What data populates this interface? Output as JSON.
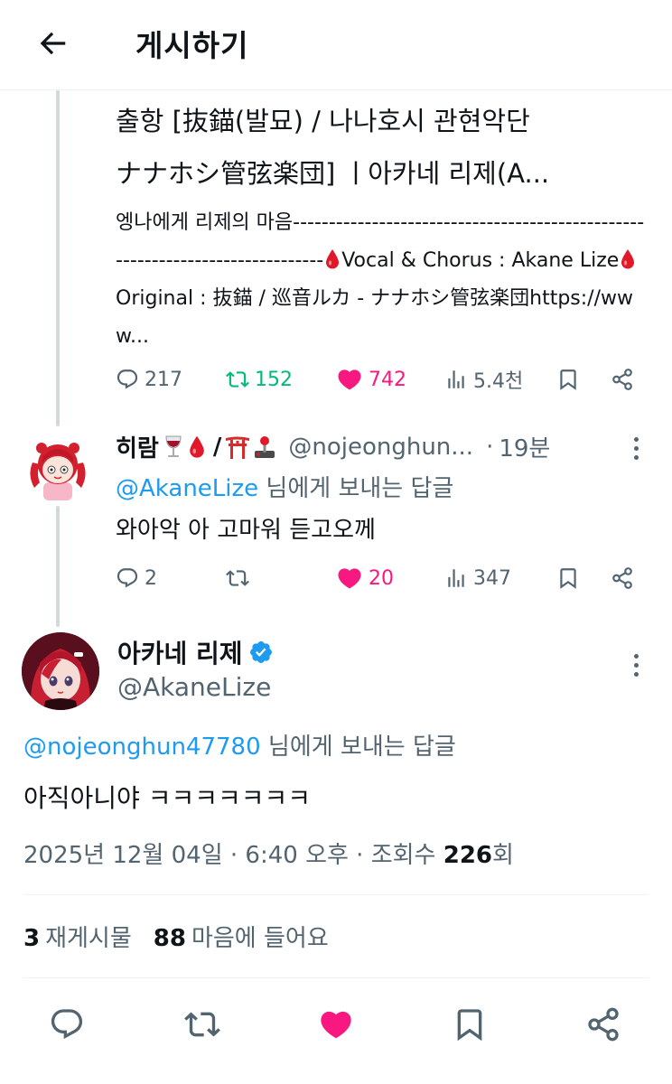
{
  "header": {
    "title": "게시하기"
  },
  "card": {
    "title_line1": "출항 [抜錨(발묘) / 나나호시 관현악단",
    "title_line2": "ナナホシ管弦楽団] ㅣ아카네 리제(A...",
    "desc_part1": "엥나에게 리제의 마음------------------------------------------------------------------------------",
    "desc_part2": "Vocal & Chorus : Akane Lize",
    "desc_part3": "Original : 抜錨 / 巡音ルカ - ナナホシ管弦楽団https://www..."
  },
  "parent_actions": {
    "replies": "217",
    "reposts": "152",
    "likes": "742",
    "views": "5.4천"
  },
  "reply": {
    "name": "히람",
    "handle": "@nojeonghun...",
    "dot": "·",
    "time": "19분",
    "reply_to_mention": "@AkaneLize",
    "reply_to_suffix": " 님에게 보내는 답글",
    "text": "와아악 아 고마워 듣고오께"
  },
  "reply_actions": {
    "replies": "2",
    "reposts": "",
    "likes": "20",
    "views": "347"
  },
  "main": {
    "name": "아카네 리제",
    "handle": "@AkaneLize",
    "reply_to_mention": "@nojeonghun47780",
    "reply_to_suffix": " 님에게 보내는 답글",
    "text": "아직아니야 ㅋㅋㅋㅋㅋㅋㅋ",
    "timestamp": "2025년 12월 04일 · 6:40 오후 · 조회수 ",
    "views": "226",
    "views_unit": "회"
  },
  "stats": {
    "reposts_count": "3",
    "reposts_label": "재게시물",
    "likes_count": "88",
    "likes_label": "마음에 들어요"
  },
  "colors": {
    "accent": "#1d9bf0",
    "like": "#f91880",
    "repost": "#00ba7c",
    "secondary_text": "#536471",
    "verified": "#1d9bf0"
  },
  "icons": [
    "back-arrow-icon",
    "reply-icon",
    "repost-icon",
    "heart-icon",
    "views-icon",
    "bookmark-icon",
    "share-icon",
    "more-icon",
    "verified-badge-icon",
    "blood-drop-icon",
    "wine-glass-emoji",
    "torii-emoji",
    "joystick-emoji"
  ]
}
